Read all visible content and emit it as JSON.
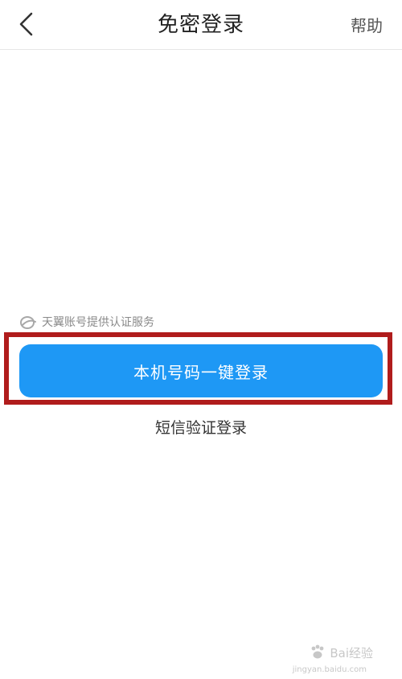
{
  "header": {
    "title": "免密登录",
    "help_label": "帮助"
  },
  "provider_notice": {
    "text": "天翼账号提供认证服务"
  },
  "login": {
    "one_click_label": "本机号码一键登录",
    "sms_label": "短信验证登录"
  },
  "watermark": {
    "brand": "Bai经验",
    "url": "jingyan.baidu.com"
  },
  "colors": {
    "primary_button": "#1e98f5",
    "highlight_border": "#b01c1c"
  }
}
